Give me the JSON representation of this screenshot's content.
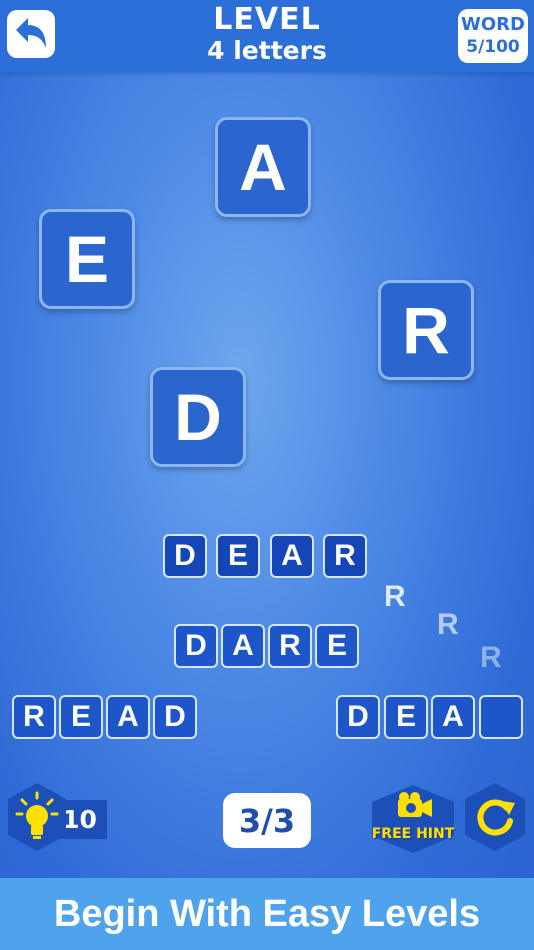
{
  "header": {
    "title": "LEVEL",
    "subtitle": "4 letters",
    "word_label": "WORD",
    "word_progress": "5/100"
  },
  "tiles": [
    "A",
    "E",
    "R",
    "D"
  ],
  "words": {
    "dear": [
      "D",
      "E",
      "A",
      "R"
    ],
    "dare": [
      "D",
      "A",
      "R",
      "E"
    ],
    "read": [
      "R",
      "E",
      "A",
      "D"
    ],
    "partial": [
      "D",
      "E",
      "A",
      ""
    ]
  },
  "flying_letters": [
    "R",
    "R",
    "R"
  ],
  "hints": {
    "count": "10"
  },
  "progress": "3/3",
  "free_hint_label": "FREE HINT",
  "footer": "Begin With Easy Levels",
  "colors": {
    "accent": "#2d6fd8",
    "hint_yellow": "#ffe000",
    "hex_dark": "#1c4fb8"
  }
}
